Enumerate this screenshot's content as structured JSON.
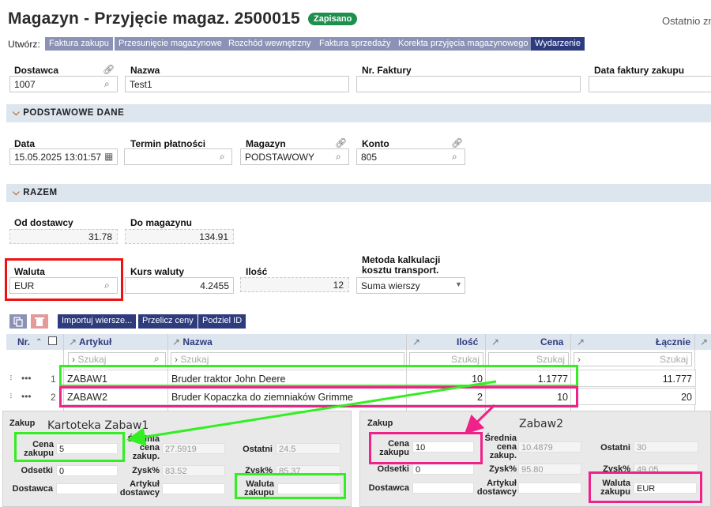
{
  "header": {
    "title": "Magazyn - Przyjęcie magaz. 2500015",
    "status": "Zapisano",
    "last_info": "Ostatnio zm"
  },
  "create": {
    "label": "Utwórz:",
    "buttons": [
      "Faktura zakupu",
      "Przesunięcie magazynowe",
      "Rozchód wewnętrzny",
      "Faktura sprzedaży",
      "Korekta przyjęcia magazynowego",
      "Wydarzenie"
    ]
  },
  "top": {
    "dostawca_label": "Dostawca",
    "dostawca": "1007",
    "nazwa_label": "Nazwa",
    "nazwa": "Test1",
    "nr_faktury_label": "Nr. Faktury",
    "nr_faktury": "",
    "data_faktury_label": "Data faktury zakupu",
    "data_faktury": ""
  },
  "sections": {
    "basic": "PODSTAWOWE DANE",
    "total": "RAZEM"
  },
  "basic": {
    "data_label": "Data",
    "data": "15.05.2025 13:01:57",
    "termin_label": "Termin płatności",
    "termin": "",
    "magazyn_label": "Magazyn",
    "magazyn": "PODSTAWOWY",
    "konto_label": "Konto",
    "konto": "805"
  },
  "total": {
    "od_dostawcy_label": "Od dostawcy",
    "od_dostawcy": "31.78",
    "do_magazynu_label": "Do magazynu",
    "do_magazynu": "134.91",
    "waluta_label": "Waluta",
    "waluta": "EUR",
    "kurs_label": "Kurs waluty",
    "kurs": "4.2455",
    "ilosc_label": "Ilość",
    "ilosc": "12",
    "metoda_label": "Metoda kalkulacji kosztu transport.",
    "metoda": "Suma wierszy"
  },
  "toolbar": {
    "import": "Importuj wiersze...",
    "recalc": "Przelicz ceny",
    "split": "Podziel ID"
  },
  "grid": {
    "headers": {
      "nr": "Nr.",
      "artykul": "Artykuł",
      "nazwa": "Nazwa",
      "ilosc": "Ilość",
      "cena": "Cena",
      "lacznie": "Łącznie"
    },
    "filter_placeholder": "Szukaj",
    "rows": [
      {
        "nr": "1",
        "artykul": "ZABAW1",
        "nazwa": "Bruder traktor John Deere",
        "ilosc": "10",
        "cena": "1.1777",
        "lacznie": "11.777"
      },
      {
        "nr": "2",
        "artykul": "ZABAW2",
        "nazwa": "Bruder Kopaczka do ziemniaków Grimme",
        "ilosc": "2",
        "cena": "10",
        "lacznie": "20"
      }
    ]
  },
  "panel1": {
    "heading": "Zakup",
    "caption": "Kartoteka Zabaw1",
    "cena_label": "Cena zakupu",
    "cena": "5",
    "srednia_label": "Średnia cena zakup.",
    "srednia": "27.5919",
    "ostatni_label": "Ostatni",
    "ostatni": "24.5",
    "odsetki_label": "Odsetki",
    "odsetki": "0",
    "zysk_label": "Zysk%",
    "zysk": "83.52",
    "zysk2_label": "Zysk%",
    "zysk2": "85.37",
    "dostawca_label": "Dostawca",
    "artykul_label": "Artykuł dostawcy",
    "waluta_label": "Waluta zakupu",
    "waluta": ""
  },
  "panel2": {
    "heading": "Zakup",
    "caption": "Zabaw2",
    "cena_label": "Cena zakupu",
    "cena": "10",
    "srednia_label": "Średnia cena zakup.",
    "srednia": "10.4879",
    "ostatni_label": "Ostatni",
    "ostatni": "30",
    "odsetki_label": "Odsetki",
    "odsetki": "0",
    "zysk_label": "Zysk%",
    "zysk": "95.80",
    "zysk2_label": "Zysk%",
    "zysk2": "49.05",
    "dostawca_label": "Dostawca",
    "artykul_label": "Artykuł dostawcy",
    "waluta_label": "Waluta zakupu",
    "waluta": "EUR"
  },
  "colors": {
    "highlight_red": "#ee1111",
    "highlight_green": "#33ee22",
    "highlight_pink": "#ee2288",
    "nav_dark": "#2e3b7d",
    "nav_light": "#8c92b5",
    "status_green": "#1f8f4e"
  }
}
